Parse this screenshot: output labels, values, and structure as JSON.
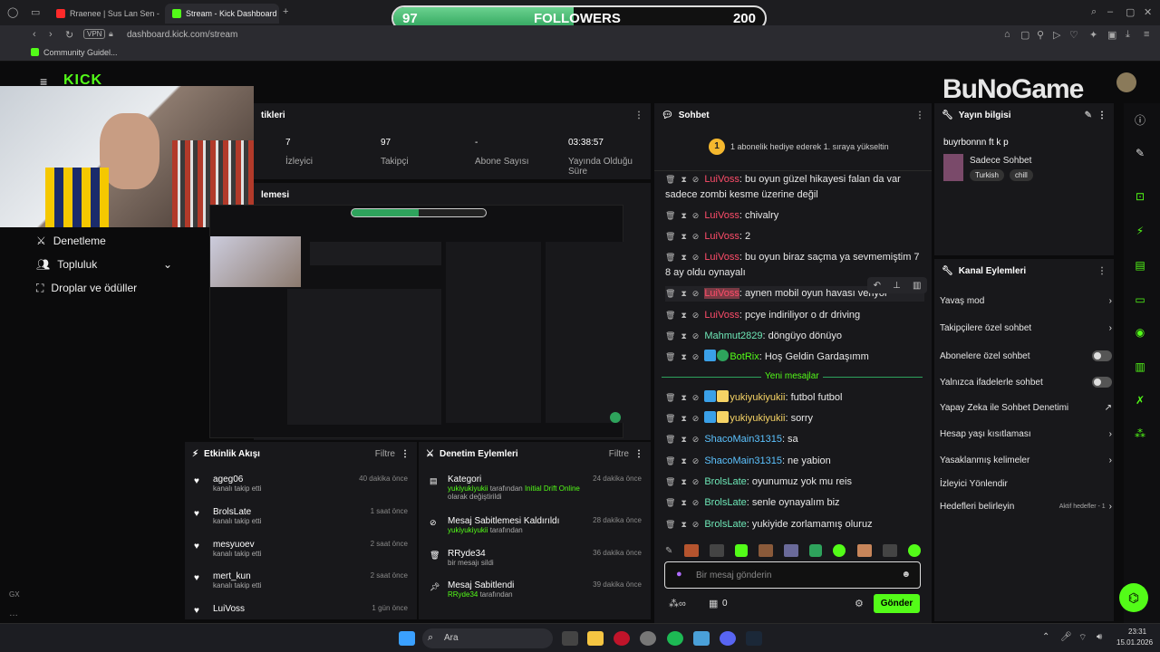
{
  "browser": {
    "tabs": [
      {
        "label": "Rraenee | Sus Lan Sen - Y",
        "color": "#ff2a2a"
      },
      {
        "label": "Stream - Kick Dashboard",
        "color": "#53fc18"
      }
    ],
    "vpn": "VPN",
    "url": "dashboard.kick.com/stream",
    "bookmark": "Community Guidel..."
  },
  "followers_bar": {
    "left": "97",
    "title": "FOLLOWERS",
    "right": "200",
    "progress": 0.485
  },
  "logo": "KICK",
  "watermark": "BuNoGame",
  "stats": {
    "header": "tikleri",
    "items": [
      {
        "value": "7",
        "label": "İzleyici"
      },
      {
        "value": "97",
        "label": "Takipçi"
      },
      {
        "value": "-",
        "label": "Abone Sayısı"
      },
      {
        "value": "03:38:57",
        "label": "Yayında Olduğu Süre"
      }
    ]
  },
  "preview_header": "lemesi",
  "sidebar": {
    "items": [
      {
        "label": "Denetleme"
      },
      {
        "label": "Topluluk"
      },
      {
        "label": "Droplar ve ödüller"
      }
    ]
  },
  "activity": {
    "title": "Etkinlik Akışı",
    "filter": "Filtre",
    "items": [
      {
        "name": "ageg06",
        "sub": "kanalı takip etti",
        "time": "40 dakika önce"
      },
      {
        "name": "BrolsLate",
        "sub": "kanalı takip etti",
        "time": "1 saat önce"
      },
      {
        "name": "mesyuoev",
        "sub": "kanalı takip etti",
        "time": "2 saat önce"
      },
      {
        "name": "mert_kun",
        "sub": "kanalı takip etti",
        "time": "2 saat önce"
      },
      {
        "name": "LuiVoss",
        "sub": "",
        "time": "1 gün önce"
      }
    ]
  },
  "modlog": {
    "title": "Denetim Eylemleri",
    "filter": "Filtre",
    "items": [
      {
        "name": "Kategori",
        "user": "yukiyukiyukii",
        "sub": " tarafından ",
        "hl": "Initial Drift Online",
        "sub2": " olarak değiştirildi",
        "time": "24 dakika önce"
      },
      {
        "name": "Mesaj Sabitlemesi Kaldırıldı",
        "user": "yukiyukiyukii",
        "sub": " tarafından",
        "hl": "",
        "sub2": "",
        "time": "28 dakika önce"
      },
      {
        "name": "RRyde34",
        "user": "",
        "sub": "bir mesajı sildi",
        "hl": "",
        "sub2": "",
        "time": "36 dakika önce"
      },
      {
        "name": "Mesaj Sabitlendi",
        "user": "RRyde34",
        "sub": " tarafından",
        "hl": "",
        "sub2": "",
        "time": "39 dakika önce"
      }
    ]
  },
  "chat": {
    "title": "Sohbet",
    "promo_badge": "1",
    "promo": "1 abonelik hediye ederek 1. sıraya yükseltin",
    "new_messages": "Yeni mesajlar",
    "input_placeholder": "Bir mesaj gönderin",
    "count": "0",
    "send": "Gönder",
    "messages": [
      {
        "user": "LuiVoss",
        "text": ": bu oyun güzel hikayesi falan da var sadece zombi kesme üzerine değil",
        "cls": "u-red"
      },
      {
        "user": "LuiVoss",
        "text": ": chivalry",
        "cls": "u-red"
      },
      {
        "user": "LuiVoss",
        "text": ": 2",
        "cls": "u-red"
      },
      {
        "user": "LuiVoss",
        "text": ": bu oyun biraz saçma ya sevmemiştim 7 8 ay oldu oynayalı",
        "cls": "u-red"
      },
      {
        "user": "LuiVoss",
        "text": ": aynen mobil oyun havası veriyor",
        "cls": "u-red"
      },
      {
        "user": "LuiVoss",
        "text": ": pcye indiriliyor o dr driving",
        "cls": "u-red"
      },
      {
        "user": "Mahmut2829",
        "text": ": döngüyo dönüyo",
        "cls": "u-teal"
      },
      {
        "user": "BotRix",
        "text": ": Hoş Geldin Gardaşımm",
        "cls": "u-green"
      },
      {
        "user": "yukiyukiyukii",
        "text": ": futbol futbol",
        "cls": "u-yel"
      },
      {
        "user": "yukiyukiyukii",
        "text": ": sorry",
        "cls": "u-yel"
      },
      {
        "user": "ShacoMain31315",
        "text": ": sa",
        "cls": "u-blue"
      },
      {
        "user": "ShacoMain31315",
        "text": ": ne yabion",
        "cls": "u-blue"
      },
      {
        "user": "BrolsLate",
        "text": ": oyunumuz yok mu reis",
        "cls": "u-teal"
      },
      {
        "user": "BrolsLate",
        "text": ": senle oynayalım biz",
        "cls": "u-teal"
      },
      {
        "user": "BrolsLate",
        "text": ": yukiyide zorlamamış oluruz",
        "cls": "u-teal"
      }
    ]
  },
  "stream_info": {
    "title": "Yayın bilgisi",
    "stream_title": "buyrbonnn ft k p",
    "mode": "Sadece Sohbet",
    "tags": [
      "Turkish",
      "chill"
    ]
  },
  "channel_actions": {
    "title": "Kanal Eylemleri",
    "items": [
      {
        "label": "Yavaş mod",
        "ctrl": "arrow"
      },
      {
        "label": "Takipçilere özel sohbet",
        "ctrl": "arrow"
      },
      {
        "label": "Abonelere özel sohbet",
        "ctrl": "toggle"
      },
      {
        "label": "Yalnızca ifadelerle sohbet",
        "ctrl": "toggle"
      },
      {
        "label": "Yapay Zeka ile Sohbet Denetimi",
        "ctrl": "ext"
      },
      {
        "label": "Hesap yaşı kısıtlaması",
        "ctrl": "arrow"
      },
      {
        "label": "Yasaklanmış kelimeler",
        "ctrl": "arrow"
      },
      {
        "label": "İzleyici Yönlendir",
        "ctrl": "none"
      },
      {
        "label": "Hedefleri belirleyin",
        "ctrl": "arrow"
      }
    ],
    "goals_status": "Aktif hedefler - 1"
  },
  "taskbar": {
    "search": "Ara",
    "time": "23:31",
    "date": "15.01.2026"
  },
  "gx": "GX"
}
